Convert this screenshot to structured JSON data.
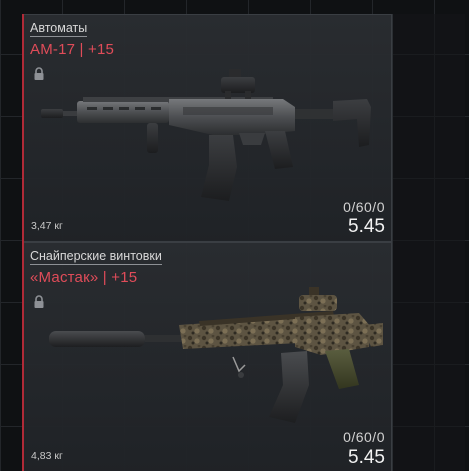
{
  "weapons": [
    {
      "category": "Автоматы",
      "name": "AM-17 | +15",
      "weight": "3,47 кг",
      "ammo": "0/60/0",
      "caliber": "5.45"
    },
    {
      "category": "Снайперские винтовки",
      "name": "«Мастак» | +15",
      "weight": "4,83 кг",
      "ammo": "0/60/0",
      "caliber": "5.45"
    }
  ],
  "colors": {
    "accent": "#e04c59",
    "card_border": "#3a3e43",
    "background": "#0f1113"
  },
  "icons": {
    "lock": "lock-icon"
  }
}
